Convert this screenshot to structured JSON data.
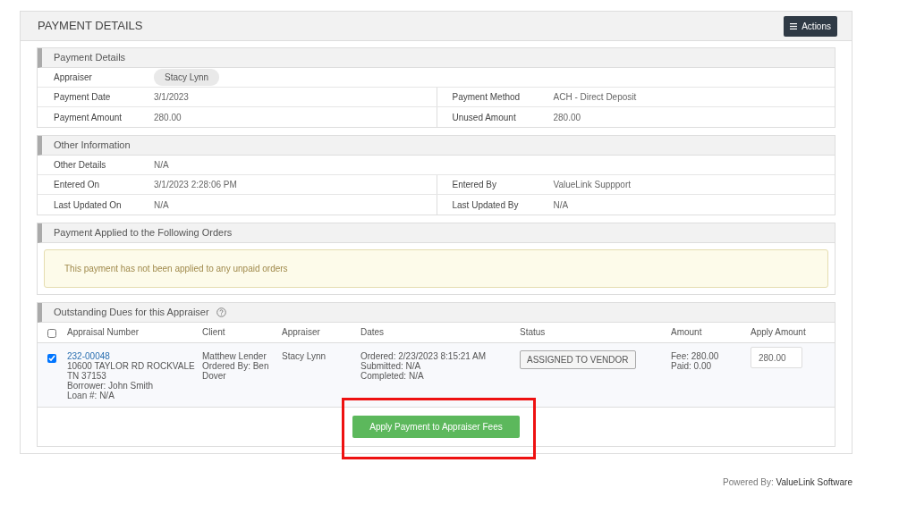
{
  "panel": {
    "title": "PAYMENT DETAILS",
    "actions_button": "Actions"
  },
  "sections": [
    {
      "title": "Payment Details",
      "rows": [
        [
          {
            "label": "Appraiser",
            "value": "Stacy Lynn",
            "kind": "chip"
          }
        ],
        [
          {
            "label": "Payment Date",
            "value": "3/1/2023",
            "kind": "text"
          },
          {
            "label": "Payment Method",
            "value": "ACH - Direct Deposit",
            "kind": "text"
          }
        ],
        [
          {
            "label": "Payment Amount",
            "value": "280.00",
            "kind": "text"
          },
          {
            "label": "Unused Amount",
            "value": "280.00",
            "kind": "text"
          }
        ]
      ]
    },
    {
      "title": "Other Information",
      "rows": [
        [
          {
            "label": "Other Details",
            "value": "N/A",
            "kind": "text"
          }
        ],
        [
          {
            "label": "Entered On",
            "value": "3/1/2023 2:28:06 PM",
            "kind": "text"
          },
          {
            "label": "Entered By",
            "value": "ValueLink Suppport",
            "kind": "text"
          }
        ],
        [
          {
            "label": "Last Updated On",
            "value": "N/A",
            "kind": "text"
          },
          {
            "label": "Last Updated By",
            "value": "N/A",
            "kind": "text"
          }
        ]
      ]
    }
  ],
  "applied_orders": {
    "title": "Payment Applied to the Following Orders",
    "notice": "This payment has not been applied to any unpaid orders"
  },
  "outstanding": {
    "title": "Outstanding Dues for this Appraiser",
    "select_all_checked": false,
    "columns": [
      "Appraisal Number",
      "Client",
      "Appraiser",
      "Dates",
      "Status",
      "Amount",
      "Apply Amount"
    ],
    "rows": [
      {
        "checked": true,
        "appraisal_number": "232-00048",
        "address": "10600 TAYLOR RD ROCKVALE TN 37153",
        "borrower": "Borrower: John Smith",
        "loan": "Loan #: N/A",
        "client": "Matthew Lender",
        "ordered_by": "Ordered By: Ben Dover",
        "appraiser": "Stacy Lynn",
        "ordered": "Ordered: 2/23/2023 8:15:21 AM",
        "submitted": "Submitted: N/A",
        "completed": "Completed: N/A",
        "status": "ASSIGNED TO VENDOR",
        "fee": "Fee: 280.00",
        "paid": "Paid: 0.00",
        "apply_amount": "280.00"
      }
    ],
    "apply_button": {
      "label": "Apply Payment to Appraiser Fees",
      "highlighted": true
    }
  },
  "footer": {
    "prefix": "Powered By:",
    "brand": "ValueLink Software"
  }
}
